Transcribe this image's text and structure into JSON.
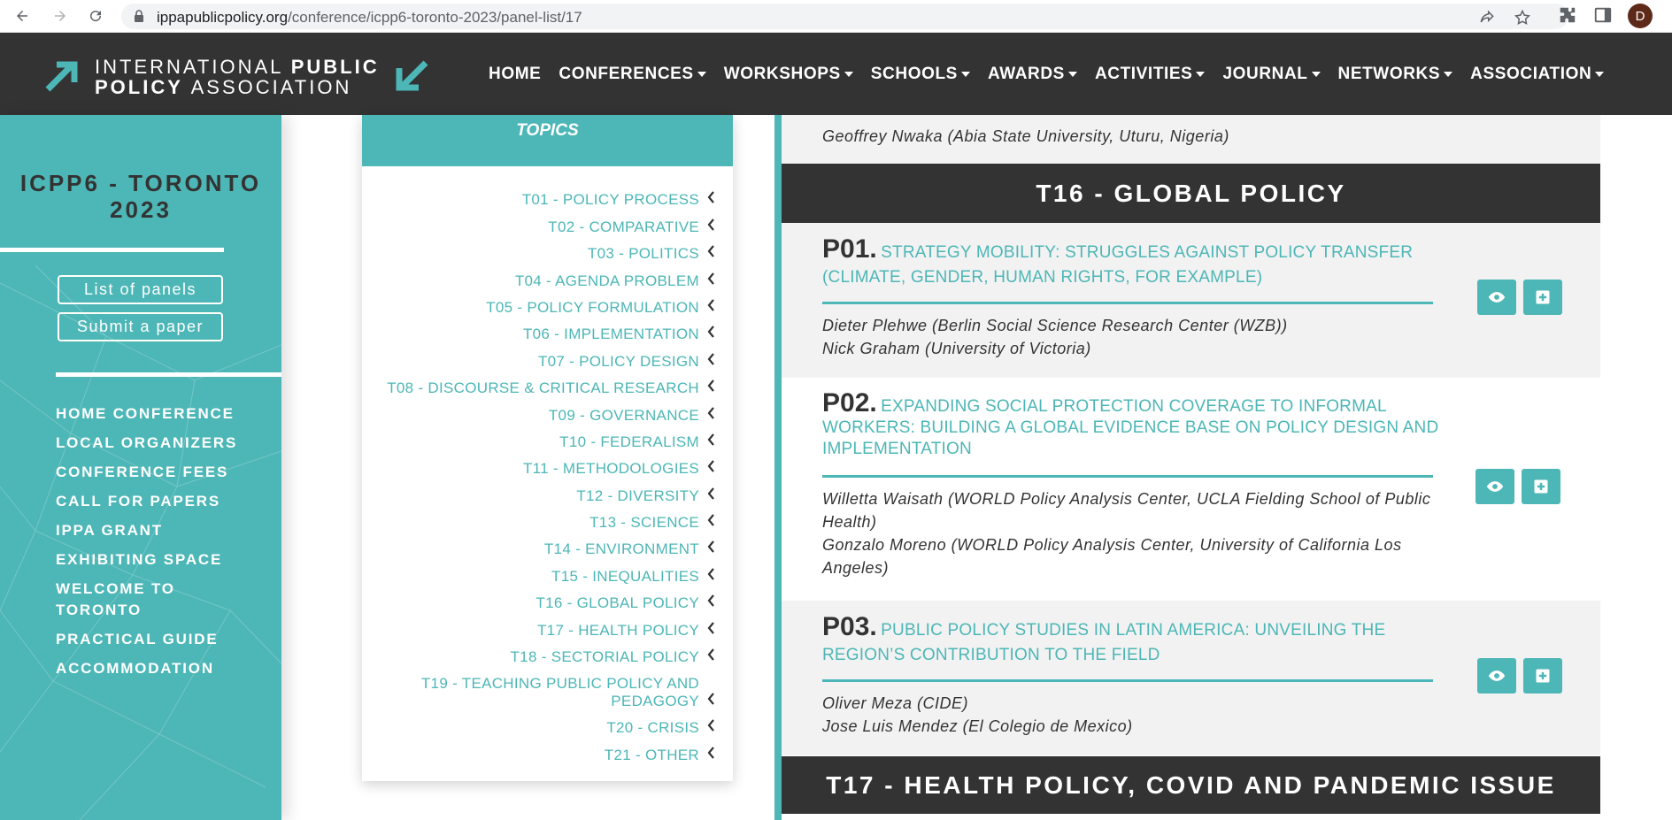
{
  "browser": {
    "url_domain": "ippapublicpolicy.org",
    "url_path": "/conference/icpp6-toronto-2023/panel-list/17",
    "avatar_letter": "D"
  },
  "header": {
    "logo_line1_a": "INTERNATIONAL ",
    "logo_line1_b": "PUBLIC",
    "logo_line2_a": "POLICY ",
    "logo_line2_b": "ASSOCIATION",
    "nav": [
      "HOME",
      "CONFERENCES",
      "WORKSHOPS",
      "SCHOOLS",
      "AWARDS",
      "ACTIVITIES",
      "JOURNAL",
      "NETWORKS",
      "ASSOCIATION"
    ]
  },
  "sidebar": {
    "title_line1": "ICPP6 - TORONTO",
    "title_line2": "2023",
    "buttons": [
      "List of panels",
      "Submit a paper"
    ],
    "menu": [
      "HOME CONFERENCE",
      "LOCAL ORGANIZERS",
      "CONFERENCE FEES",
      "CALL FOR PAPERS",
      "IPPA GRANT",
      "EXHIBITING SPACE",
      "WELCOME TO TORONTO",
      "PRACTICAL GUIDE",
      "ACCOMMODATION"
    ]
  },
  "topics": {
    "heading": "TOPICS",
    "items": [
      "T01 - POLICY PROCESS",
      "T02 - COMPARATIVE",
      "T03 - POLITICS",
      "T04 - AGENDA PROBLEM",
      "T05 - POLICY FORMULATION",
      "T06 - IMPLEMENTATION",
      "T07 - POLICY DESIGN",
      "T08 - DISCOURSE & CRITICAL RESEARCH",
      "T09 - GOVERNANCE",
      "T10 - FEDERALISM",
      "T11 - METHODOLOGIES",
      "T12 - DIVERSITY",
      "T13 - SCIENCE",
      "T14 - ENVIRONMENT",
      "T15 - INEQUALITIES",
      "T16 - GLOBAL POLICY",
      "T17 - HEALTH POLICY",
      "T18 - SECTORIAL POLICY",
      "T19 - TEACHING PUBLIC POLICY AND PEDAGOGY",
      "T20 - CRISIS",
      "T21 - OTHER"
    ]
  },
  "main": {
    "prev_author": "Geoffrey Nwaka (Abia State University, Uturu, Nigeria)",
    "section_t16": "T16 - GLOBAL POLICY",
    "panels": [
      {
        "num": "P01.",
        "title": "STRATEGY MOBILITY: STRUGGLES AGAINST POLICY TRANSFER (CLIMATE, GENDER, HUMAN RIGHTS, FOR EXAMPLE)",
        "authors": [
          "Dieter Plehwe (Berlin Social Science Research Center (WZB))",
          "Nick Graham (University of Victoria)"
        ]
      },
      {
        "num": "P02.",
        "title": "EXPANDING SOCIAL PROTECTION COVERAGE TO INFORMAL WORKERS: BUILDING A GLOBAL EVIDENCE BASE ON POLICY DESIGN AND IMPLEMENTATION",
        "authors": [
          "Willetta Waisath (WORLD Policy Analysis Center, UCLA Fielding School of Public Health)",
          "Gonzalo Moreno (WORLD Policy Analysis Center, University of California Los Angeles)"
        ]
      },
      {
        "num": "P03.",
        "title": "PUBLIC POLICY STUDIES IN LATIN AMERICA: UNVEILING THE REGION’S CONTRIBUTION TO THE FIELD",
        "authors": [
          "Oliver Meza (CIDE)",
          "Jose Luis Mendez (El Colegio de Mexico)"
        ]
      }
    ],
    "section_t17": "T17 - HEALTH POLICY, COVID AND PANDEMIC ISSUE"
  },
  "colors": {
    "teal": "#4db6b6",
    "dark": "#333333",
    "grey": "#f2f2f2"
  }
}
